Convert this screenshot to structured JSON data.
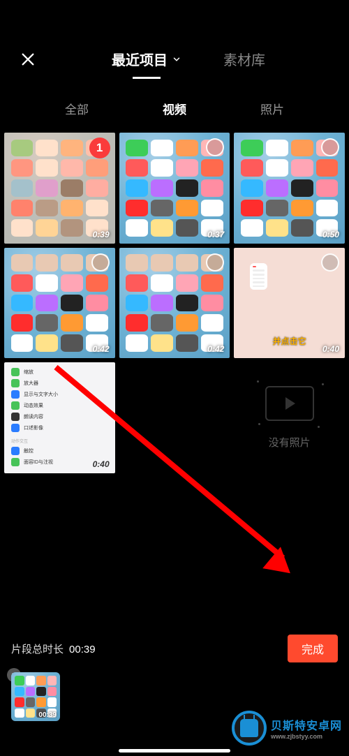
{
  "header": {
    "recent_label": "最近项目",
    "library_label": "素材库"
  },
  "filters": {
    "all": "全部",
    "video": "视频",
    "photo": "照片"
  },
  "grid": [
    {
      "duration": "0:39",
      "selected_index": "1"
    },
    {
      "duration": "0:37"
    },
    {
      "duration": "0:50"
    },
    {
      "duration": "0:42"
    },
    {
      "duration": "0:42"
    },
    {
      "duration": "0:40",
      "pink_caption": "并点击它"
    },
    {
      "duration": "0:40"
    }
  ],
  "settings_list": {
    "s0": "缩放",
    "s1": "放大器",
    "s2": "显示与文字大小",
    "s3": "动态效果",
    "s4": "朗读内容",
    "s5": "口述影像",
    "grp": "动作交互",
    "s6": "触控",
    "s7": "面容ID与注视"
  },
  "empty": {
    "label": "没有照片"
  },
  "bottom": {
    "total_label": "片段总时长",
    "total_value": "00:39",
    "done": "完成",
    "selected_duration": "00:39"
  },
  "watermark": {
    "title": "贝斯特安卓网",
    "url": "www.zjbstyy.com"
  }
}
